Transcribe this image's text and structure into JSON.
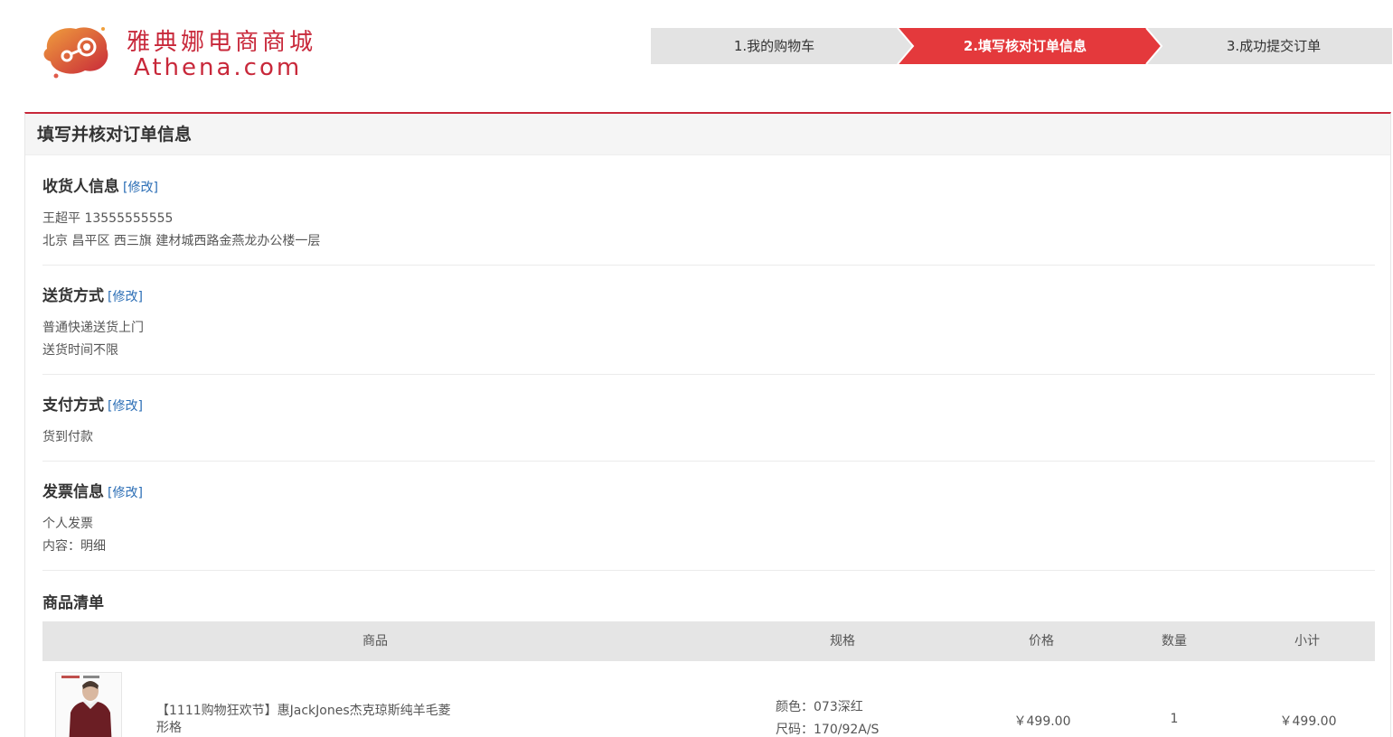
{
  "brand": {
    "name_cn": "雅典娜电商商城",
    "name_en": "Athena.com",
    "accent": "#c8283a"
  },
  "steps": [
    {
      "label": "1.我的购物车",
      "active": false
    },
    {
      "label": "2.填写核对订单信息",
      "active": true
    },
    {
      "label": "3.成功提交订单",
      "active": false
    }
  ],
  "panel": {
    "title": "填写并核对订单信息"
  },
  "edit_label": "[修改]",
  "sections": {
    "receiver": {
      "title": "收货人信息",
      "lines": [
        "王超平 13555555555",
        "北京 昌平区 西三旗 建材城西路金燕龙办公楼一层"
      ]
    },
    "delivery": {
      "title": "送货方式",
      "lines": [
        "普通快递送货上门",
        "送货时间不限"
      ]
    },
    "payment": {
      "title": "支付方式",
      "lines": [
        "货到付款"
      ]
    },
    "invoice": {
      "title": "发票信息",
      "lines": [
        "个人发票",
        "内容：明细"
      ]
    }
  },
  "goods": {
    "title": "商品清单",
    "headers": {
      "product": "商品",
      "spec": "规格",
      "price": "价格",
      "qty": "数量",
      "subtotal": "小计"
    },
    "items": [
      {
        "name_line1": "【1111购物狂欢节】惠JackJones杰克琼斯纯羊毛菱",
        "name_line2": "形格",
        "color": "颜色：073深红",
        "size": "尺码：170/92A/S",
        "price": "￥499.00",
        "qty": "1",
        "subtotal": "￥499.00"
      }
    ]
  }
}
